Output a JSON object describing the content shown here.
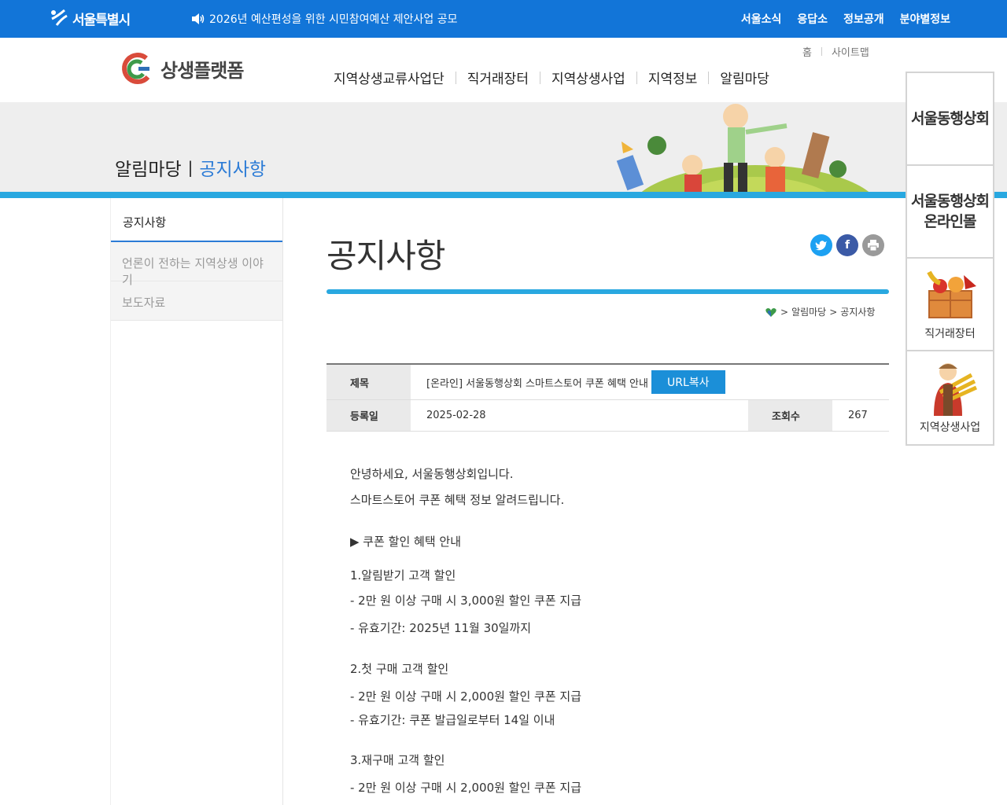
{
  "topbar": {
    "city_logo": "서울특별시",
    "notice": "2026년 예산편성을 위한 시민참여예산 제안사업 공모",
    "links": [
      "서울소식",
      "응답소",
      "정보공개",
      "분야별정보"
    ]
  },
  "header": {
    "logo_text": "상생플랫폼",
    "util": [
      "홈",
      "사이트맵"
    ],
    "nav": [
      "지역상생교류사업단",
      "직거래장터",
      "지역상생사업",
      "지역정보",
      "알림마당"
    ]
  },
  "banner": {
    "section": "알림마당",
    "current": "공지사항"
  },
  "sidebar": {
    "head": "공지사항",
    "items": [
      "언론이 전하는 지역상생 이야기",
      "보도자료"
    ]
  },
  "content": {
    "title": "공지사항",
    "breadcrumb": [
      "알림마당",
      "공지사항"
    ],
    "meta": {
      "subject_label": "제목",
      "subject": "[온라인] 서울동행상회 스마트스토어 쿠폰 혜택 안내",
      "url_button": "URL복사",
      "date_label": "등록일",
      "date": "2025-02-28",
      "views_label": "조회수",
      "views": "267"
    },
    "body": [
      "안녕하세요, 서울동행상회입니다.",
      "스마트스토어 쿠폰 혜택 정보 알려드립니다.",
      "▶ 쿠폰 할인 혜택 안내",
      "1.알림받기 고객 할인",
      "- 2만 원 이상 구매 시 3,000원 할인 쿠폰 지급",
      "- 유효기간: 2025년 11월 30일까지",
      "2.첫 구매 고객 할인",
      "- 2만 원 이상 구매 시 2,000원 할인 쿠폰 지급",
      "- 유효기간: 쿠폰 발급일로부터 14일 이내",
      "3.재구매 고객 할인",
      "- 2만 원 이상 구매 시 2,000원 할인 쿠폰 지급"
    ]
  },
  "quick_menu": {
    "item1": "서울동행상회",
    "item2": "서울동행상회 온라인몰",
    "item3": "직거래장터",
    "item4": "지역상생사업"
  },
  "colors": {
    "topbar": "#1275d8",
    "accent": "#29a8e0",
    "link": "#2b7bd6"
  }
}
